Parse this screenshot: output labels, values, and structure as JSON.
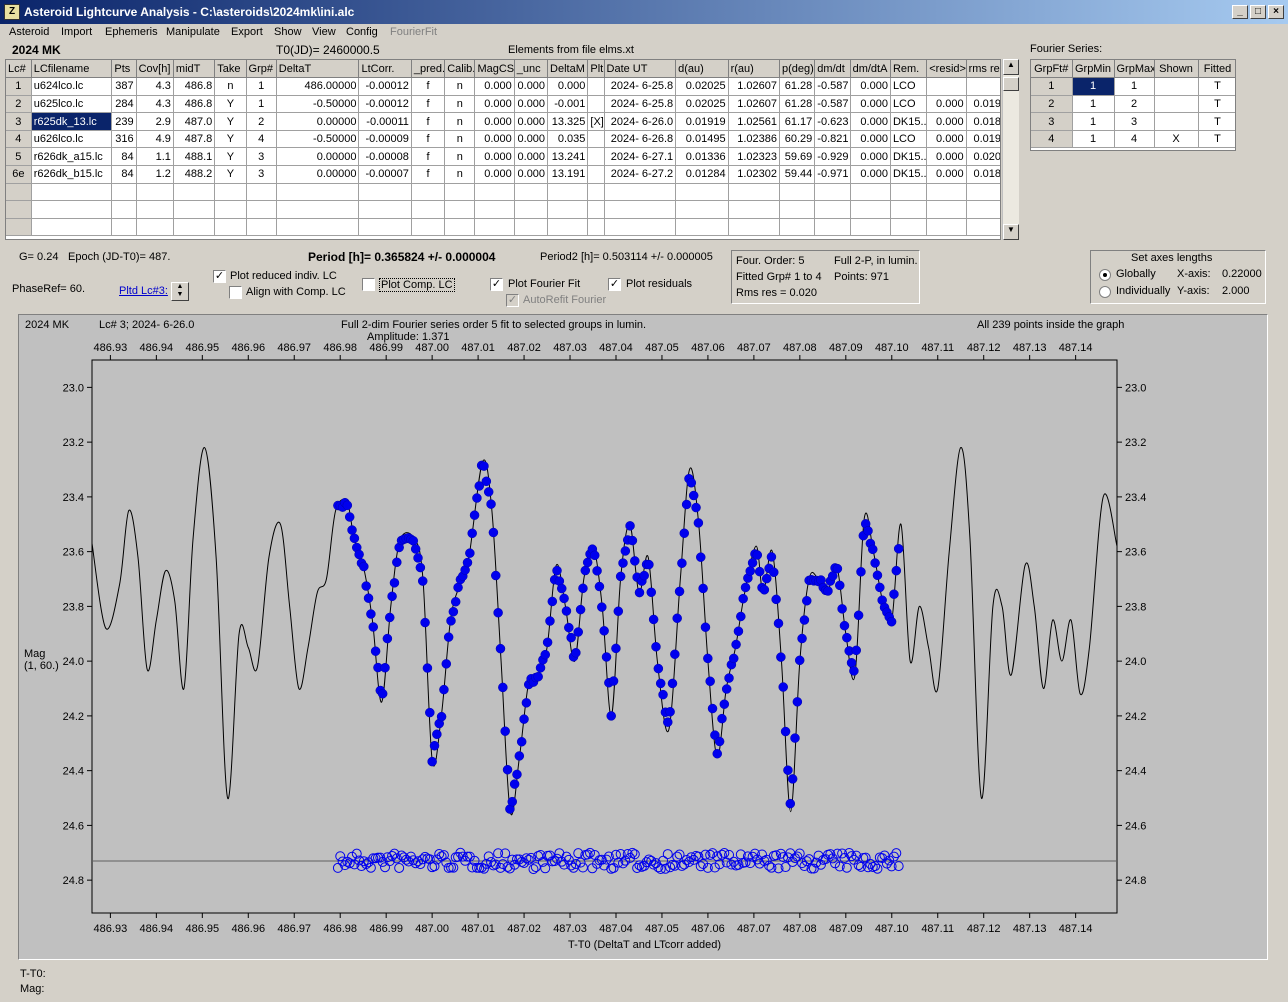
{
  "window": {
    "title": "Asteroid Lightcurve Analysis - C:\\asteroids\\2024mk\\ini.alc",
    "icon_letter": "Z"
  },
  "menu": [
    "Asteroid",
    "Import",
    "Ephemeris",
    "Manipulate",
    "Export",
    "Show",
    "View",
    "Config",
    "FourierFit"
  ],
  "header": {
    "object": "2024 MK",
    "t0": "T0(JD)= 2460000.5",
    "elements": "Elements from file elms.xt",
    "fourier_label": "Fourier Series:"
  },
  "lc_table": {
    "columns": [
      "Lc#",
      "LCfilename",
      "Pts",
      "Cov[h]",
      "midT",
      "Take",
      "Grp#",
      "DeltaT",
      "LtCorr.",
      "_pred.",
      "Calib.",
      "MagCS",
      "_unc",
      "DeltaM",
      "Plt",
      "Date UT",
      "d(au)",
      "r(au)",
      "p(deg)",
      "dm/dt",
      "dm/dtA",
      "Rem.",
      "<resid>",
      "rms res"
    ],
    "rows": [
      [
        "1",
        "u624lco.lc",
        "387",
        "4.3",
        "486.8",
        "n",
        "1",
        "486.00000",
        "-0.00012",
        "f",
        "n",
        "0.000",
        "0.000",
        "0.000",
        "",
        "2024- 6-25.8",
        "0.02025",
        "1.02607",
        "61.28",
        "-0.587",
        "0.000",
        "LCO",
        "",
        ""
      ],
      [
        "2",
        "u625lco.lc",
        "284",
        "4.3",
        "486.8",
        "Y",
        "1",
        "-0.50000",
        "-0.00012",
        "f",
        "n",
        "0.000",
        "0.000",
        "-0.001",
        "",
        "2024- 6-25.8",
        "0.02025",
        "1.02607",
        "61.28",
        "-0.587",
        "0.000",
        "LCO",
        "0.000",
        "0.019"
      ],
      [
        "3",
        "r625dk_13.lc",
        "239",
        "2.9",
        "487.0",
        "Y",
        "2",
        "0.00000",
        "-0.00011",
        "f",
        "n",
        "0.000",
        "0.000",
        "13.325",
        "[X]",
        "2024- 6-26.0",
        "0.01919",
        "1.02561",
        "61.17",
        "-0.623",
        "0.000",
        "DK15..",
        "0.000",
        "0.018"
      ],
      [
        "4",
        "u626lco.lc",
        "316",
        "4.9",
        "487.8",
        "Y",
        "4",
        "-0.50000",
        "-0.00009",
        "f",
        "n",
        "0.000",
        "0.000",
        "0.035",
        "",
        "2024- 6-26.8",
        "0.01495",
        "1.02386",
        "60.29",
        "-0.821",
        "0.000",
        "LCO",
        "0.000",
        "0.019"
      ],
      [
        "5",
        "r626dk_a15.lc",
        "84",
        "1.1",
        "488.1",
        "Y",
        "3",
        "0.00000",
        "-0.00008",
        "f",
        "n",
        "0.000",
        "0.000",
        "13.241",
        "",
        "2024- 6-27.1",
        "0.01336",
        "1.02323",
        "59.69",
        "-0.929",
        "0.000",
        "DK15..",
        "0.000",
        "0.020"
      ],
      [
        "6e",
        "r626dk_b15.lc",
        "84",
        "1.2",
        "488.2",
        "Y",
        "3",
        "0.00000",
        "-0.00007",
        "f",
        "n",
        "0.000",
        "0.000",
        "13.191",
        "",
        "2024- 6-27.2",
        "0.01284",
        "1.02302",
        "59.44",
        "-0.971",
        "0.000",
        "DK15..",
        "0.000",
        "0.018"
      ]
    ],
    "empty_rows": 3,
    "selected_row": 2
  },
  "fourier_table": {
    "columns": [
      "GrpFt#",
      "GrpMin",
      "GrpMax",
      "Shown",
      "Fitted"
    ],
    "rows": [
      [
        "1",
        "1",
        "1",
        "",
        "T"
      ],
      [
        "2",
        "1",
        "2",
        "",
        "T"
      ],
      [
        "3",
        "1",
        "3",
        "",
        "T"
      ],
      [
        "4",
        "1",
        "4",
        "X",
        "T"
      ]
    ]
  },
  "controls": {
    "g_label": "G= 0.24",
    "epoch": "Epoch (JD-T0)= 487.",
    "period_label": "Period [h]= ",
    "period_value": "0.365824 +/- 0.000004",
    "period2": "Period2 [h]= 0.503114 +/- 0.000005",
    "phaseref": "PhaseRef= 60.",
    "pltd_lc": "Pltd Lc#3:",
    "plot_reduced": "Plot reduced indiv. LC",
    "plot_reduced_checked": true,
    "align_comp": "Align with Comp. LC",
    "align_comp_checked": false,
    "plot_comp": "Plot Comp. LC",
    "plot_comp_checked": false,
    "plot_fourier": "Plot Fourier Fit",
    "plot_fourier_checked": true,
    "autorefit": "AutoRefit Fourier",
    "autorefit_checked": true,
    "plot_residuals": "Plot residuals",
    "plot_residuals_checked": true
  },
  "fourier_info": {
    "order": "Four. Order:  5",
    "full": "Full 2-P, in lumin.",
    "fitted": "Fitted Grp# 1 to 4",
    "points": "Points: 971",
    "rms": "Rms res     = 0.020"
  },
  "axes_box": {
    "title": "Set axes lengths",
    "globally": "Globally",
    "individually": "Individually",
    "xaxis_label": "X-axis:",
    "xaxis_value": "0.22000",
    "yaxis_label": "Y-axis:",
    "yaxis_value": "2.000",
    "selected": "globally"
  },
  "plot": {
    "object": "2024 MK",
    "lc_info": "Lc# 3; 2024- 6-26.0",
    "fit_title": "Full 2-dim Fourier series order 5 fit to selected groups in lumin.",
    "amplitude": "Amplitude: 1.371",
    "points_info": "All 239 points inside the graph",
    "ylabel_line1": "Mag",
    "ylabel_line2": "(1, 60.)",
    "xlabel": "T-T0 (DeltaT and LTcorr added)"
  },
  "status": {
    "t_label": "T-T0:",
    "mag_label": "Mag:"
  },
  "colors": {
    "data_points": "#0000ee",
    "fit_line": "#000000",
    "plot_bg": "#c0c0c0",
    "selection": "#0a246a"
  },
  "chart_data": {
    "type": "scatter",
    "xlim": [
      486.926,
      487.149
    ],
    "ylim": [
      24.92,
      22.9
    ],
    "y_inverted": true,
    "xticks": [
      "486.93",
      "486.94",
      "486.95",
      "486.96",
      "486.97",
      "486.98",
      "486.99",
      "487.00",
      "487.01",
      "487.02",
      "487.03",
      "487.04",
      "487.05",
      "487.06",
      "487.07",
      "487.08",
      "487.09",
      "487.10",
      "487.11",
      "487.12",
      "487.13",
      "487.14"
    ],
    "yticks": [
      "23.0",
      "23.2",
      "23.4",
      "23.6",
      "23.8",
      "24.0",
      "24.2",
      "24.4",
      "24.6",
      "24.8"
    ],
    "fit_curve": [
      [
        486.926,
        23.57
      ],
      [
        486.929,
        23.88
      ],
      [
        486.932,
        23.72
      ],
      [
        486.934,
        23.45
      ],
      [
        486.936,
        23.62
      ],
      [
        486.938,
        24.03
      ],
      [
        486.94,
        23.85
      ],
      [
        486.942,
        23.67
      ],
      [
        486.944,
        23.78
      ],
      [
        486.946,
        24.1
      ],
      [
        486.948,
        23.55
      ],
      [
        486.9505,
        23.22
      ],
      [
        486.953,
        23.62
      ],
      [
        486.9555,
        24.5
      ],
      [
        486.958,
        23.9
      ],
      [
        486.96,
        23.95
      ],
      [
        486.962,
        24.02
      ],
      [
        486.9645,
        23.62
      ],
      [
        486.967,
        23.5
      ],
      [
        486.969,
        23.8
      ],
      [
        486.971,
        24.1
      ],
      [
        486.973,
        23.95
      ],
      [
        486.975,
        23.75
      ],
      [
        486.977,
        23.7
      ],
      [
        486.979,
        23.45
      ],
      [
        486.9815,
        23.42
      ],
      [
        486.983,
        23.55
      ],
      [
        486.985,
        23.65
      ],
      [
        486.987,
        23.85
      ],
      [
        486.989,
        24.15
      ],
      [
        486.991,
        23.8
      ],
      [
        486.993,
        23.56
      ],
      [
        486.996,
        23.55
      ],
      [
        486.998,
        23.7
      ],
      [
        487.0,
        24.36
      ],
      [
        487.002,
        24.2
      ],
      [
        487.004,
        23.85
      ],
      [
        487.006,
        23.72
      ],
      [
        487.008,
        23.62
      ],
      [
        487.011,
        23.27
      ],
      [
        487.013,
        23.45
      ],
      [
        487.015,
        24.0
      ],
      [
        487.017,
        24.55
      ],
      [
        487.019,
        24.35
      ],
      [
        487.021,
        24.08
      ],
      [
        487.023,
        24.05
      ],
      [
        487.025,
        23.95
      ],
      [
        487.027,
        23.65
      ],
      [
        487.029,
        23.8
      ],
      [
        487.031,
        24.0
      ],
      [
        487.033,
        23.7
      ],
      [
        487.035,
        23.58
      ],
      [
        487.037,
        23.8
      ],
      [
        487.039,
        24.2
      ],
      [
        487.041,
        23.7
      ],
      [
        487.043,
        23.5
      ],
      [
        487.045,
        23.75
      ],
      [
        487.047,
        23.62
      ],
      [
        487.049,
        24.0
      ],
      [
        487.0515,
        24.25
      ],
      [
        487.054,
        23.7
      ],
      [
        487.056,
        23.3
      ],
      [
        487.058,
        23.5
      ],
      [
        487.06,
        24.0
      ],
      [
        487.062,
        24.35
      ],
      [
        487.064,
        24.1
      ],
      [
        487.066,
        23.95
      ],
      [
        487.068,
        23.75
      ],
      [
        487.0705,
        23.58
      ],
      [
        487.072,
        23.75
      ],
      [
        487.074,
        23.6
      ],
      [
        487.076,
        24.0
      ],
      [
        487.078,
        24.55
      ],
      [
        487.08,
        24.0
      ],
      [
        487.082,
        23.7
      ],
      [
        487.084,
        23.7
      ],
      [
        487.086,
        23.75
      ],
      [
        487.088,
        23.65
      ],
      [
        487.09,
        23.9
      ],
      [
        487.092,
        24.05
      ],
      [
        487.094,
        23.48
      ],
      [
        487.096,
        23.6
      ],
      [
        487.098,
        23.78
      ],
      [
        487.1,
        23.85
      ],
      [
        487.102,
        23.5
      ],
      [
        487.104,
        24.0
      ],
      [
        487.106,
        23.8
      ],
      [
        487.108,
        23.95
      ],
      [
        487.11,
        24.1
      ],
      [
        487.1125,
        23.6
      ],
      [
        487.115,
        23.22
      ],
      [
        487.117,
        23.55
      ],
      [
        487.1195,
        24.5
      ],
      [
        487.122,
        23.8
      ],
      [
        487.124,
        23.8
      ],
      [
        487.126,
        24.05
      ],
      [
        487.129,
        23.65
      ],
      [
        487.131,
        23.8
      ],
      [
        487.133,
        24.1
      ],
      [
        487.135,
        23.85
      ],
      [
        487.137,
        24.0
      ],
      [
        487.139,
        23.85
      ],
      [
        487.141,
        24.12
      ],
      [
        487.143,
        23.95
      ],
      [
        487.146,
        23.4
      ],
      [
        487.149,
        23.58
      ]
    ],
    "point_segment": {
      "x_start": 486.9795,
      "x_end": 487.1015,
      "n": 239
    },
    "residual_level": 24.73,
    "residual_spread": 0.03
  }
}
